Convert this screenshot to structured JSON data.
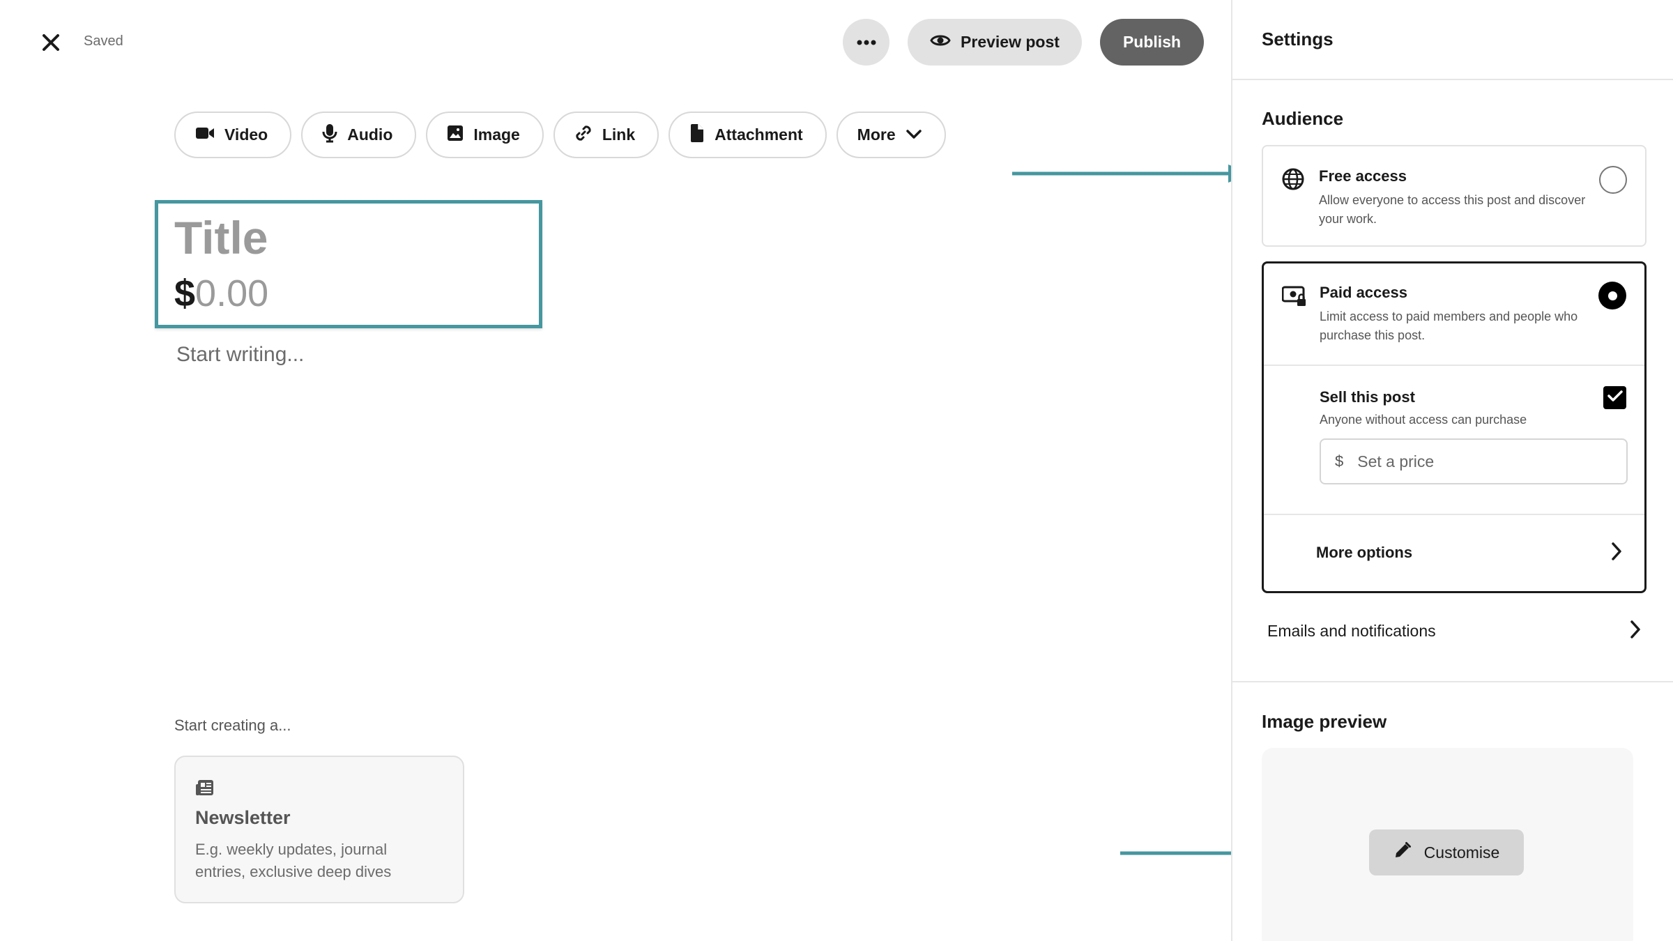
{
  "header": {
    "saved_label": "Saved",
    "preview_label": "Preview post",
    "publish_label": "Publish"
  },
  "media_buttons": [
    {
      "label": "Video",
      "icon": "video-camera-icon"
    },
    {
      "label": "Audio",
      "icon": "microphone-icon"
    },
    {
      "label": "Image",
      "icon": "image-icon"
    },
    {
      "label": "Link",
      "icon": "link-icon"
    },
    {
      "label": "Attachment",
      "icon": "file-icon"
    },
    {
      "label": "More",
      "icon": "chevron-down-icon"
    }
  ],
  "editor": {
    "title_placeholder": "Title",
    "price_symbol": "$",
    "price_placeholder": "0.00",
    "body_placeholder": "Start writing..."
  },
  "templates": {
    "heading": "Start creating a...",
    "cards": [
      {
        "title": "Newsletter",
        "description": "E.g. weekly updates, journal entries, exclusive deep dives",
        "icon": "newspaper-icon"
      }
    ]
  },
  "settings": {
    "title": "Settings",
    "audience": {
      "heading": "Audience",
      "options": [
        {
          "title": "Free access",
          "description": "Allow everyone to access this post and discover your work.",
          "icon": "globe-icon",
          "selected": false
        },
        {
          "title": "Paid access",
          "description": "Limit access to paid members and people who purchase this post.",
          "icon": "money-lock-icon",
          "selected": true
        }
      ],
      "sell": {
        "title": "Sell this post",
        "description": "Anyone without access can purchase",
        "checked": true,
        "currency": "$",
        "price_placeholder": "Set a price"
      },
      "more_options_label": "More options"
    },
    "emails_label": "Emails and notifications",
    "image_preview": {
      "heading": "Image preview",
      "customise_label": "Customise"
    }
  },
  "colors": {
    "annotation": "#46979f",
    "publish_bg": "#636363",
    "pill_bg": "#e2e2e2"
  }
}
